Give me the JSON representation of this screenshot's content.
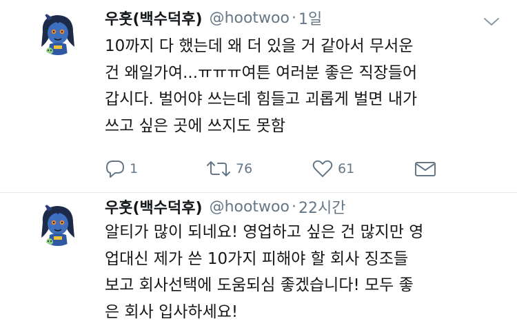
{
  "tweets": [
    {
      "display_name": "우훗(백수덕후)",
      "handle": "@hootwoo",
      "separator": "·",
      "time": "1일",
      "text": "10까지 다 했는데 왜 더 있을 거 같아서 무서운\n건 왜일가여...ㅠㅠㅠ여튼 여러분 좋은 직장들어\n갑시다. 벌어야 쓰는데 힘들고 괴롭게 벌면 내가\n쓰고 싶은 곳에 쓰지도 못함",
      "replies": "1",
      "retweets": "76",
      "likes": "61"
    },
    {
      "display_name": "우훗(백수덕후)",
      "handle": "@hootwoo",
      "separator": "·",
      "time": "22시간",
      "text": "알티가 많이 되네요! 영업하고 싶은 건 많지만 영\n업대신 제가 쓴 10가지 피해야 할 회사 징조들\n보고 회사선택에 도움되심 좋겠습니다! 모두 좋\n은 회사 입사하세요!"
    }
  ],
  "colors": {
    "text": "#14171a",
    "secondary": "#657786",
    "divider": "#e1e8ed",
    "avatar_skin": "#3f6fbf",
    "avatar_hair": "#1d2a4a"
  }
}
